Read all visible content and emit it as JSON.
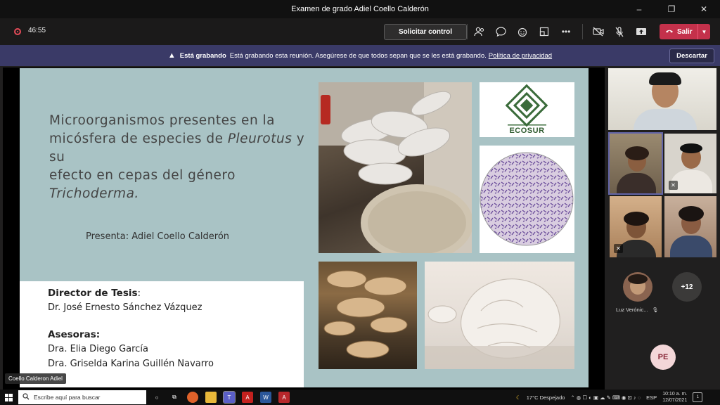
{
  "window": {
    "title": "Examen de grado Adiel Coello Calderón",
    "controls": [
      "–",
      "❐",
      "✕"
    ]
  },
  "meeting": {
    "timer": "46:55",
    "request_control_label": "Solicitar control",
    "leave_label": "Salir",
    "leave_color": "#c4314b"
  },
  "banner": {
    "bold": "Está grabando",
    "message": "Está grabando esta reunión. Asegúrese de que todos sepan que se les está grabando.",
    "link": "Política de privacidad",
    "dismiss_label": "Descartar",
    "background": "#3a3a67"
  },
  "slide": {
    "title_line1": "Microorganismos presentes en la",
    "title_line2_a": "micósfera de especies de ",
    "title_line2_italic": "Pleurotus",
    "title_line2_b": " y su",
    "title_line3_a": "efecto en cepas del género ",
    "title_line3_italic": "Trichoderma.",
    "presenter": "Presenta: Adiel Coello Calderón",
    "director_heading": "Director de Tesis",
    "director_colon": ":",
    "director_name": "Dr. José Ernesto Sánchez Vázquez",
    "advisors_heading": "Asesoras:",
    "advisor_1": "Dra. Elia Diego García",
    "advisor_2": "Dra. Griselda Karina Guillén Navarro",
    "logo_text": "ECOSUR",
    "background": "#a9c3c5"
  },
  "presenter_caption": "Coello Calderon Adiel",
  "participants": {
    "named_tile_label": "Luz Verónic...",
    "overflow_count": "+12",
    "initials": "PE"
  },
  "taskbar": {
    "search_placeholder": "Escribe aquí para buscar",
    "weather": "17°C  Despejado",
    "language": "ESP",
    "time": "10:10 a. m.",
    "date": "12/07/2021"
  }
}
